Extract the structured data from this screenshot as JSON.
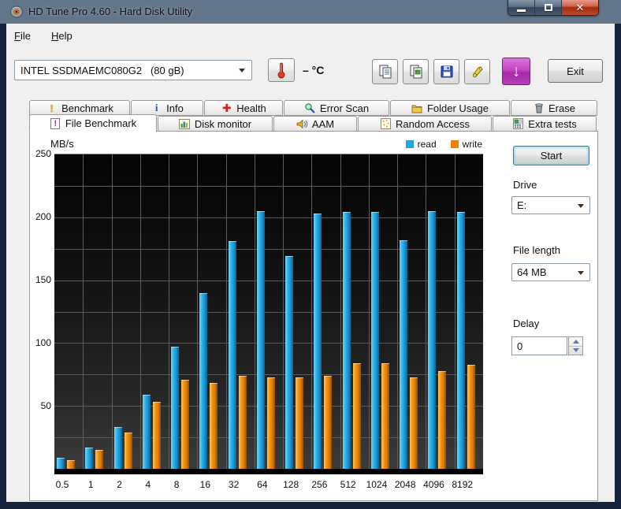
{
  "window": {
    "title": "HD Tune Pro 4.60 - Hard Disk Utility"
  },
  "menu": {
    "items": [
      {
        "label": "File"
      },
      {
        "label": "Help"
      }
    ]
  },
  "toolbar": {
    "device_combo": "INTEL SSDMAEMC080G2   (80 gB)",
    "temperature": "– °C",
    "exit_label": "Exit",
    "accent_purple": "#c347c3"
  },
  "tabs": {
    "row1": [
      {
        "label": "Benchmark",
        "icon": "exclamation-icon"
      },
      {
        "label": "Info",
        "icon": "info-icon"
      },
      {
        "label": "Health",
        "icon": "health-cross-icon"
      },
      {
        "label": "Error Scan",
        "icon": "magnifier-icon"
      },
      {
        "label": "Folder Usage",
        "icon": "folder-icon"
      },
      {
        "label": "Erase",
        "icon": "trash-icon"
      }
    ],
    "row2": [
      {
        "label": "File Benchmark",
        "icon": "file-benchmark-icon",
        "selected": true
      },
      {
        "label": "Disk monitor",
        "icon": "bar-chart-icon"
      },
      {
        "label": "AAM",
        "icon": "speaker-icon"
      },
      {
        "label": "Random Access",
        "icon": "random-dots-icon"
      },
      {
        "label": "Extra tests",
        "icon": "calculator-icon"
      }
    ]
  },
  "panel": {
    "start_label": "Start",
    "drive_label": "Drive",
    "drive_value": "E:",
    "file_length_label": "File length",
    "file_length_value": "64 MB",
    "delay_label": "Delay",
    "delay_value": "0"
  },
  "chart_data": {
    "type": "bar",
    "title": "",
    "xlabel": "",
    "ylabel": "MB/s",
    "ylim": [
      0,
      250
    ],
    "yticks": [
      50,
      100,
      150,
      200,
      250
    ],
    "grid_minor_interval": 25,
    "grid": true,
    "legend_position": "top-right",
    "categories": [
      "0.5",
      "1",
      "2",
      "4",
      "8",
      "16",
      "32",
      "64",
      "128",
      "256",
      "512",
      "1024",
      "2048",
      "4096",
      "8192"
    ],
    "series": [
      {
        "name": "read",
        "color": "#1fa7e0",
        "values": [
          9,
          17,
          33,
          59,
          97,
          140,
          181,
          205,
          169,
          203,
          204,
          204,
          182,
          205,
          204
        ]
      },
      {
        "name": "write",
        "color": "#ef8200",
        "values": [
          7,
          15,
          29,
          53,
          71,
          68,
          74,
          73,
          73,
          74,
          84,
          84,
          73,
          78,
          83
        ]
      }
    ]
  }
}
